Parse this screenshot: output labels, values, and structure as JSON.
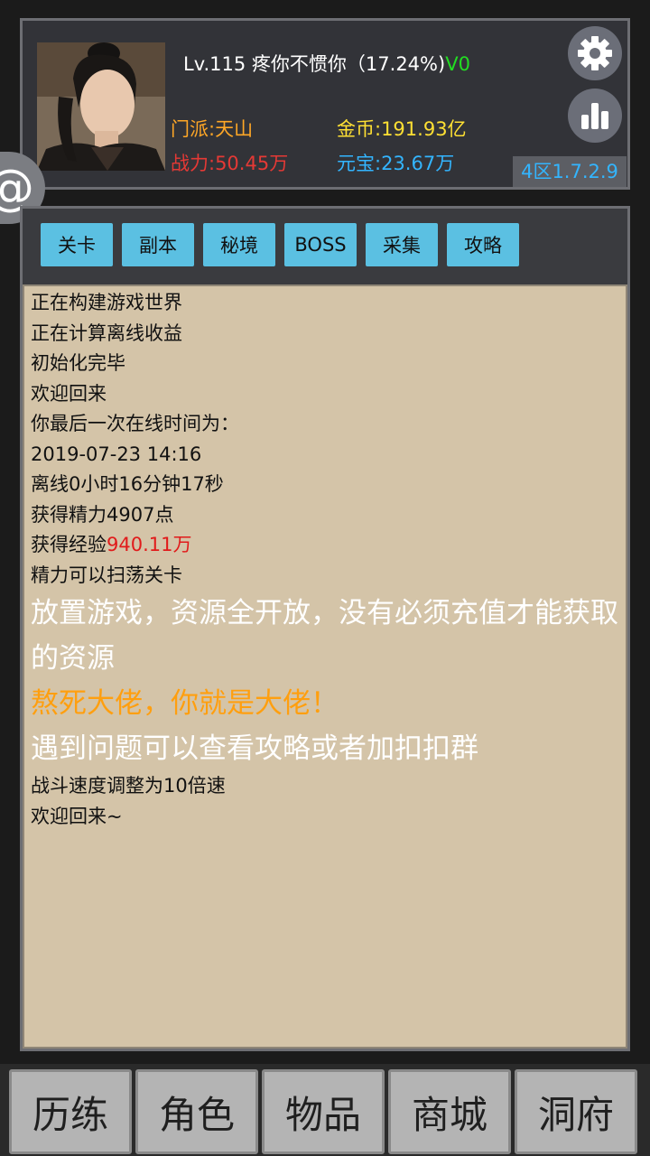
{
  "header": {
    "level_line": "Lv.115 疼你不惯你（17.24%)",
    "vip": "V0",
    "sect": "门派:天山",
    "gold": "金币:191.93亿",
    "power": "战力:50.45万",
    "ingot": "元宝:23.67万",
    "version": "4区1.7.2.9",
    "at_symbol": "@"
  },
  "tabs": [
    "关卡",
    "副本",
    "秘境",
    "BOSS",
    "采集",
    "攻略"
  ],
  "log": {
    "lines": [
      "正在构建游戏世界",
      "正在计算离线收益",
      "初始化完毕",
      "欢迎回来",
      "你最后一次在线时间为：",
      "2019-07-23 14:16",
      "离线0小时16分钟17秒",
      "获得精力4907点"
    ],
    "exp_prefix": "获得经验",
    "exp_value": "940.11万",
    "sweep": "精力可以扫荡关卡",
    "big1": "放置游戏，资源全开放，没有必须充值才能获取的资源",
    "orange": "熬死大佬，你就是大佬！",
    "big2": "遇到问题可以查看攻略或者加扣扣群",
    "speed": "战斗速度调整为10倍速",
    "welcome": "欢迎回来~"
  },
  "nav": [
    "历练",
    "角色",
    "物品",
    "商城",
    "洞府"
  ],
  "colors": {
    "tab_bg": "#5bc0e2",
    "log_bg": "#d4c4a8",
    "red": "#e11a1a",
    "orange": "#ff9f0f",
    "vip_green": "#22dd22",
    "gold_yellow": "#ffe033",
    "ingot_blue": "#33b5ff"
  },
  "icons": {
    "settings": "gear-icon",
    "stats": "bar-chart-icon",
    "mention": "at-icon"
  }
}
